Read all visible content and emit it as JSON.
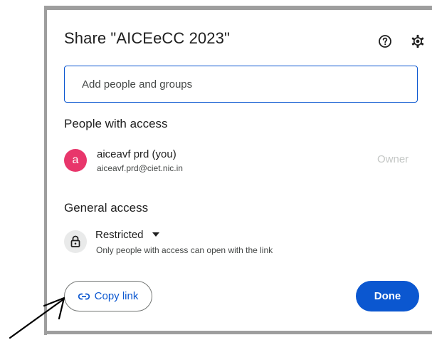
{
  "dialog": {
    "title": "Share \"AICEeCC 2023\"",
    "help_icon": "help-circle-icon",
    "settings_icon": "gear-icon"
  },
  "add_people": {
    "placeholder": "Add people and groups"
  },
  "people_with_access": {
    "heading": "People with access",
    "people": [
      {
        "avatar_letter": "a",
        "avatar_color": "#e8366b",
        "name": "aiceavf prd (you)",
        "email": "aiceavf.prd@ciet.nic.in",
        "role": "Owner"
      }
    ]
  },
  "general_access": {
    "heading": "General access",
    "icon": "lock-icon",
    "selected": "Restricted",
    "description": "Only people with access can open with the link"
  },
  "footer": {
    "copy_link_label": "Copy link",
    "copy_link_icon": "link-icon",
    "done_label": "Done"
  },
  "colors": {
    "primary": "#0b57d0",
    "frame": "#9e9e9e",
    "annotation": "#000000"
  }
}
